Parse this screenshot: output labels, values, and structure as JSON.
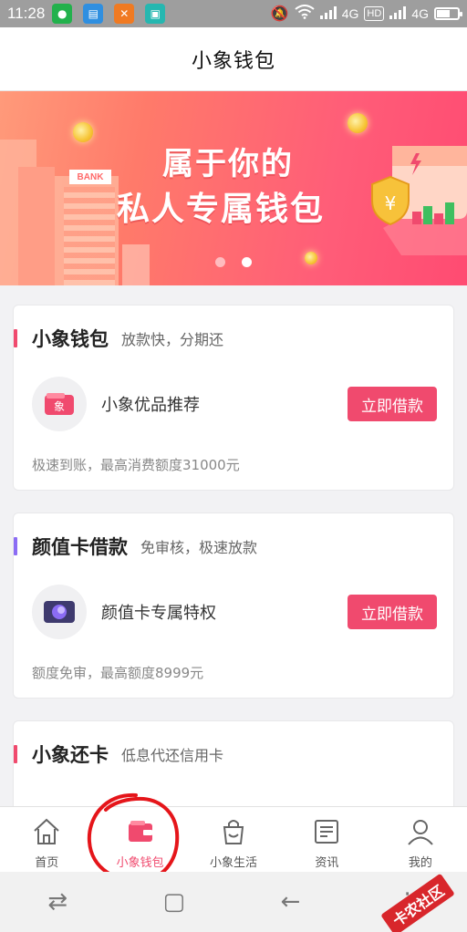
{
  "status_bar": {
    "time": "11:28",
    "network_1": "4G",
    "hd": "HD",
    "network_2": "4G",
    "battery_level": 0.65,
    "apps": [
      "wechat-icon",
      "message-icon",
      "tools-icon",
      "scan-icon"
    ]
  },
  "header": {
    "title": "小象钱包"
  },
  "banner": {
    "bank_sign": "BANK",
    "line1": "属于你的",
    "line2": "私人专属钱包",
    "active_slide": 2,
    "slide_count": 2
  },
  "cards": [
    {
      "title": "小象钱包",
      "subtitle": "放款快，分期还",
      "product": "小象优品推荐",
      "button": "立即借款",
      "note": "极速到账，最高消费额度31000元",
      "accent": "#f04a6e"
    },
    {
      "title": "颜值卡借款",
      "subtitle": "免审核，极速放款",
      "product": "颜值卡专属特权",
      "button": "立即借款",
      "note": "额度免审，最高额度8999元",
      "accent": "#8b6cf4"
    },
    {
      "title": "小象还卡",
      "subtitle": "低息代还信用卡",
      "accent": "#f04a6e"
    }
  ],
  "bottom_nav": {
    "items": [
      {
        "label": "首页",
        "icon": "home-icon"
      },
      {
        "label": "小象钱包",
        "icon": "wallet-icon",
        "active": true
      },
      {
        "label": "小象生活",
        "icon": "shopping-bag-icon"
      },
      {
        "label": "资讯",
        "icon": "news-icon"
      },
      {
        "label": "我的",
        "icon": "user-icon"
      }
    ]
  },
  "watermark": {
    "text": "卡农社区"
  },
  "colors": {
    "accent": "#f04a6e",
    "banner": "#ff6a70",
    "purple": "#8b6cf4"
  }
}
